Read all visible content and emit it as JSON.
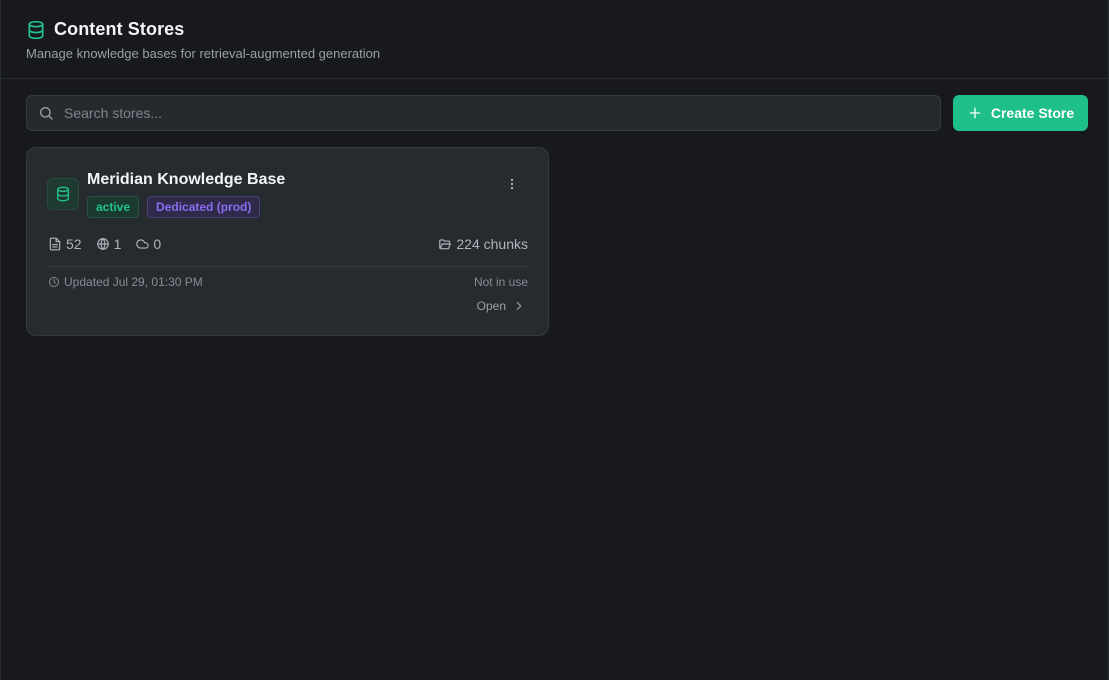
{
  "header": {
    "title": "Content Stores",
    "subtitle": "Manage knowledge bases for retrieval-augmented generation",
    "icon": "database-icon"
  },
  "toolbar": {
    "search_placeholder": "Search stores...",
    "search_value": "",
    "create_label": "Create Store"
  },
  "stores": [
    {
      "name": "Meridian Knowledge Base",
      "status": "active",
      "tier": "Dedicated (prod)",
      "stats": {
        "documents": "52",
        "web_sources": "1",
        "cloud_sources": "0"
      },
      "chunks": "224 chunks",
      "updated": "Updated Jul 29, 01:30 PM",
      "usage": "Not in use",
      "open_label": "Open"
    }
  ],
  "colors": {
    "accent": "#1fbf8c",
    "active_text": "#22c38e",
    "tier_text": "#8b6cf0",
    "background": "#17191c",
    "card": "#262b30"
  }
}
